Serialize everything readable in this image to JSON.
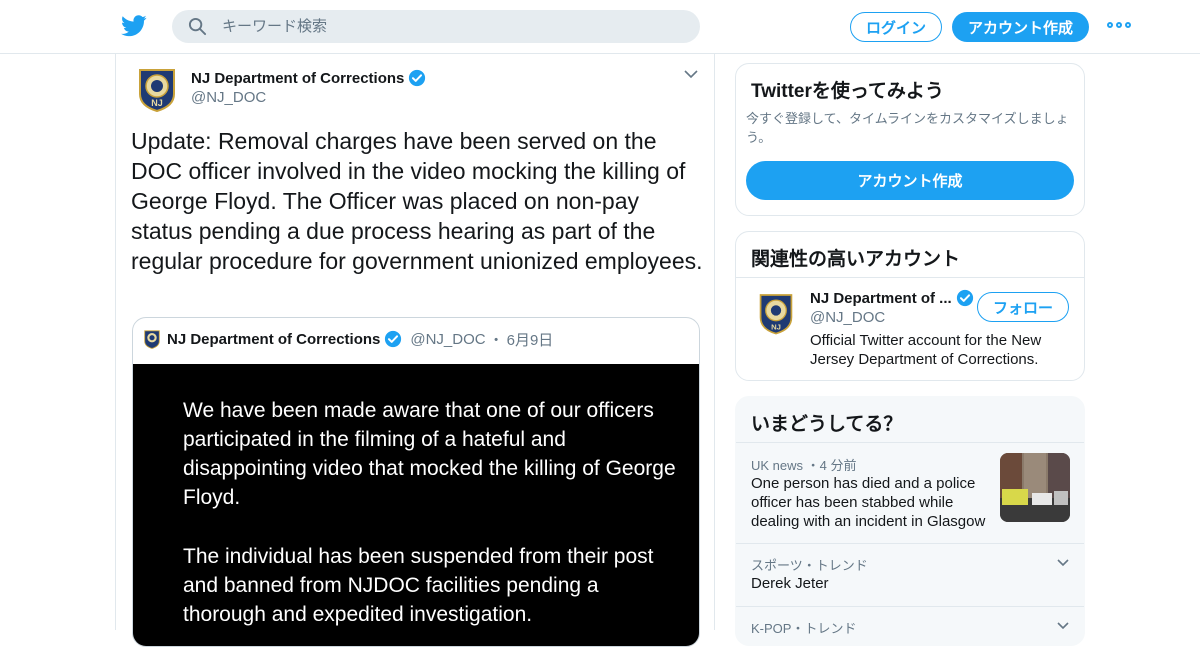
{
  "header": {
    "search_placeholder": "キーワード検索",
    "login_label": "ログイン",
    "signup_label": "アカウント作成",
    "brand_color": "#1da1f2"
  },
  "tweet": {
    "author_name": "NJ Department of Corrections",
    "author_handle": "@NJ_DOC",
    "text": "Update: Removal charges have been served on the DOC officer involved in the video mocking the killing of George Floyd. The Officer was placed on non-pay status pending a due process hearing as part of the regular procedure for government unionized employees.",
    "quote": {
      "author_name": "NJ Department of Corrections",
      "author_handle": "@NJ_DOC",
      "separator": "・",
      "date": "6月9日",
      "image_paragraph_1": "We have been made aware that one of our officers participated in the filming of a hateful and disappointing video that mocked the killing of George Floyd.",
      "image_paragraph_2": "The individual has been suspended from their post and banned from NJDOC facilities pending a thorough and expedited investigation."
    }
  },
  "sidebar": {
    "try_twitter": {
      "title": "Twitterを使ってみよう",
      "subtitle": "今すぐ登録して、タイムラインをカスタマイズしましょう。",
      "button_label": "アカウント作成"
    },
    "relevant_accounts": {
      "title": "関連性の高いアカウント",
      "account_name": "NJ Department of ...",
      "account_handle": "@NJ_DOC",
      "follow_label": "フォロー",
      "bio": "Official Twitter account for the New Jersey Department of Corrections."
    },
    "trends": {
      "title": "いまどうしてる？",
      "items": [
        {
          "meta": "UK news ・4 分前",
          "text": "One person has died and a police officer has been stabbed while dealing with an incident in Glasgow"
        },
        {
          "meta": "スポーツ・トレンド",
          "text": "Derek Jeter"
        },
        {
          "meta": "K-POP・トレンド",
          "text": ""
        }
      ]
    }
  }
}
